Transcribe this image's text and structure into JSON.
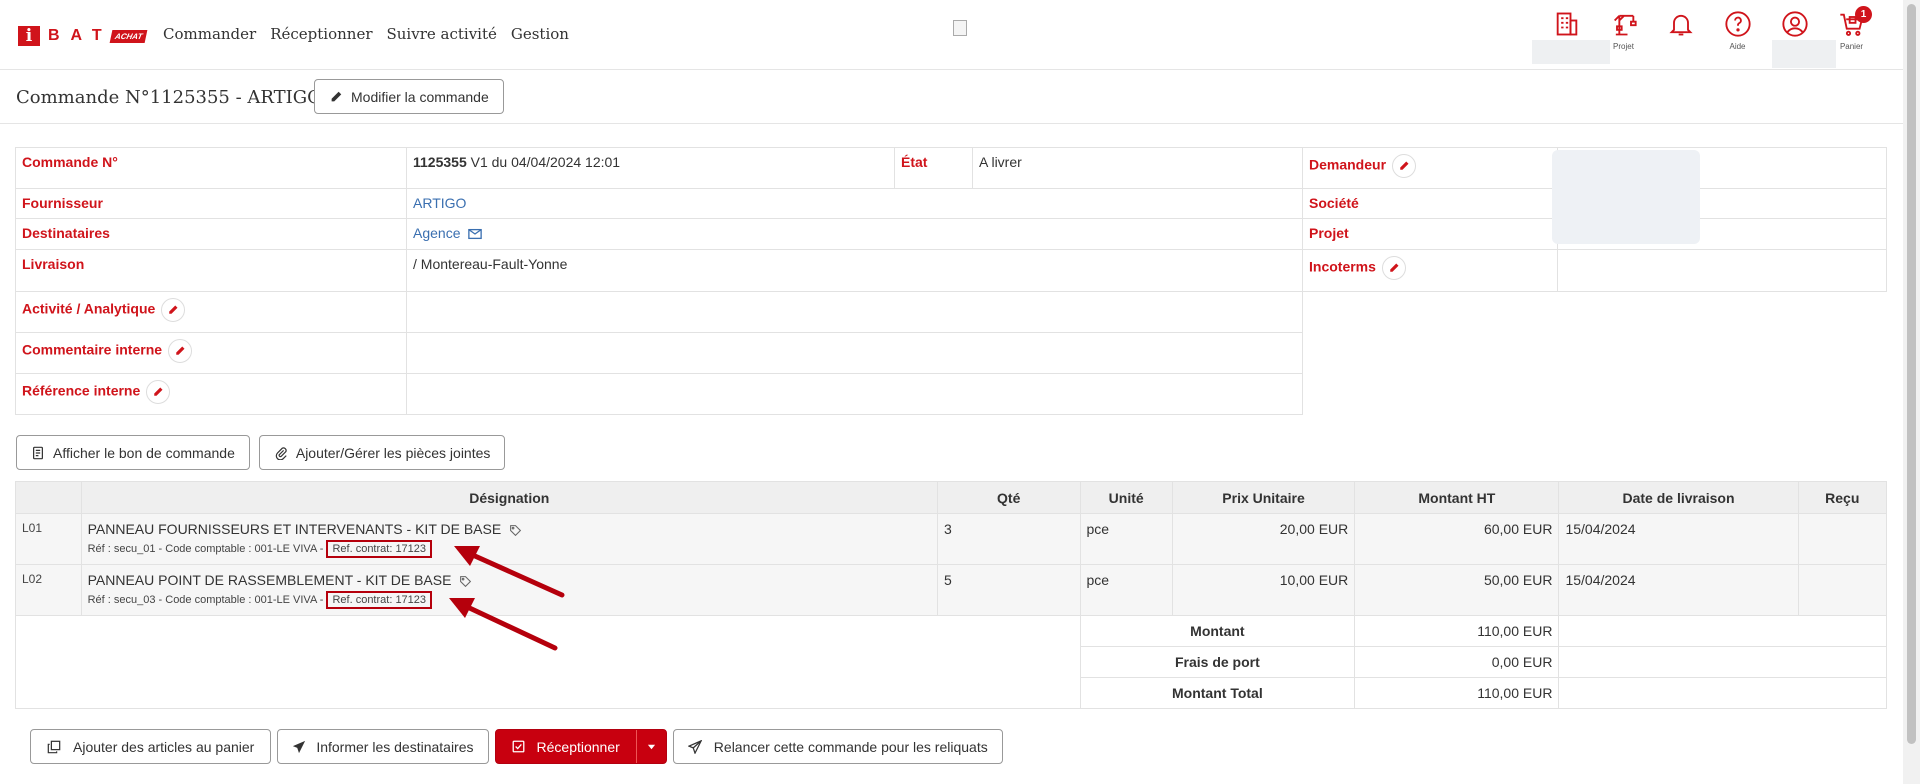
{
  "nav": {
    "logo_i": "i",
    "logo_bat": "BAT",
    "logo_achat": "ACHAT",
    "menu": [
      "Commander",
      "Réceptionner",
      "Suivre activité",
      "Gestion"
    ],
    "icons": [
      {
        "name": "company-icon",
        "label": ""
      },
      {
        "name": "crane-icon",
        "label": "Projet"
      },
      {
        "name": "bell-icon",
        "label": ""
      },
      {
        "name": "help-icon",
        "label": "Aide"
      },
      {
        "name": "user-icon",
        "label": ""
      },
      {
        "name": "cart-icon",
        "label": "Panier",
        "badge": "1"
      }
    ]
  },
  "header": {
    "title": "Commande N°1125355 - ARTIGO",
    "modify_button": "Modifier la commande"
  },
  "info": {
    "commande_label": "Commande N°",
    "commande_number": "1125355",
    "commande_version": " V1 du 04/04/2024 12:01",
    "etat_label": "État",
    "etat_value": "A livrer",
    "demandeur_label": "Demandeur",
    "fournisseur_label": "Fournisseur",
    "fournisseur_value": "ARTIGO",
    "societe_label": "Société",
    "destinataires_label": "Destinataires",
    "destinataires_value": "Agence",
    "projet_label": "Projet",
    "livraison_label": "Livraison",
    "livraison_value": "/ Montereau-Fault-Yonne",
    "incoterms_label": "Incoterms",
    "activite_label": "Activité / Analytique",
    "commentaire_label": "Commentaire interne",
    "reference_label": "Référence interne"
  },
  "actions": {
    "afficher_bon": "Afficher le bon de commande",
    "pieces_jointes": "Ajouter/Gérer les pièces jointes"
  },
  "table": {
    "headers": [
      "Désignation",
      "Qté",
      "Unité",
      "Prix Unitaire",
      "Montant HT",
      "Date de livraison",
      "Reçu"
    ],
    "rows": [
      {
        "code": "L01",
        "designation": "PANNEAU FOURNISSEURS ET INTERVENANTS - KIT DE BASE",
        "details": "Réf : secu_01 - Code comptable : 001-LE VIVA - ",
        "ref_contrat": "Ref. contrat: 17123",
        "qte": "3",
        "unite": "pce",
        "prix": "20,00 EUR",
        "montant": "60,00 EUR",
        "date": "15/04/2024"
      },
      {
        "code": "L02",
        "designation": "PANNEAU POINT DE RASSEMBLEMENT - KIT DE BASE",
        "details": "Réf : secu_03 - Code comptable : 001-LE VIVA - ",
        "ref_contrat": "Ref. contrat: 17123",
        "qte": "5",
        "unite": "pce",
        "prix": "10,00 EUR",
        "montant": "50,00 EUR",
        "date": "15/04/2024"
      }
    ],
    "totals": [
      {
        "label": "Montant",
        "value": "110,00 EUR"
      },
      {
        "label": "Frais de port",
        "value": "0,00 EUR"
      },
      {
        "label": "Montant Total",
        "value": "110,00 EUR"
      }
    ]
  },
  "footer_actions": {
    "ajouter_panier": "Ajouter des articles au panier",
    "informer": "Informer les destinataires",
    "receptionner": "Réceptionner",
    "relancer": "Relancer cette commande pour les reliquats"
  },
  "colors": {
    "brand_red": "#d0141b",
    "link_blue": "#3a6fb0",
    "annotation_red": "#b5000c"
  }
}
